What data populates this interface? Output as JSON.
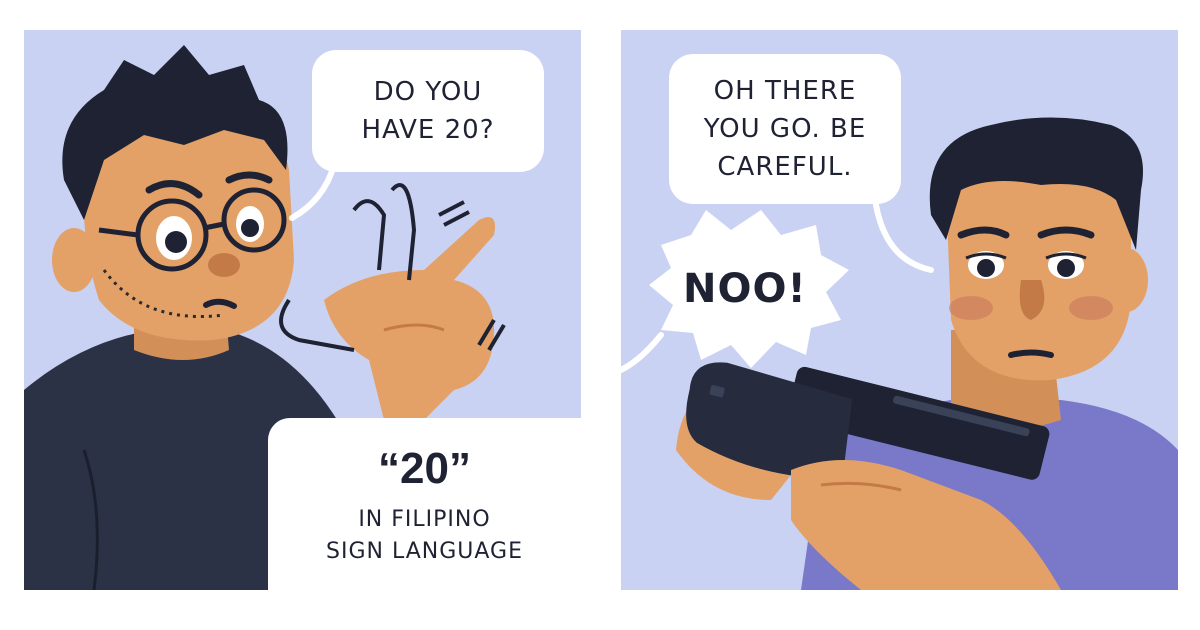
{
  "panels": {
    "left": {
      "speech": [
        "DO YOU",
        "HAVE 20?"
      ],
      "caption_title": "“20”",
      "caption_sub": [
        "IN FILIPINO",
        "SIGN LANGUAGE"
      ]
    },
    "right": {
      "speech": [
        "OH THERE",
        "YOU GO. BE",
        "CAREFUL."
      ],
      "exclamation": "NOO!"
    }
  },
  "colors": {
    "panel_bg": "#c9d2f2",
    "skin": "#e3a167",
    "hair": "#1f2233",
    "shirt_left": "#2b3246",
    "shirt_right": "#7a78c8",
    "gun": "#1f2233"
  }
}
